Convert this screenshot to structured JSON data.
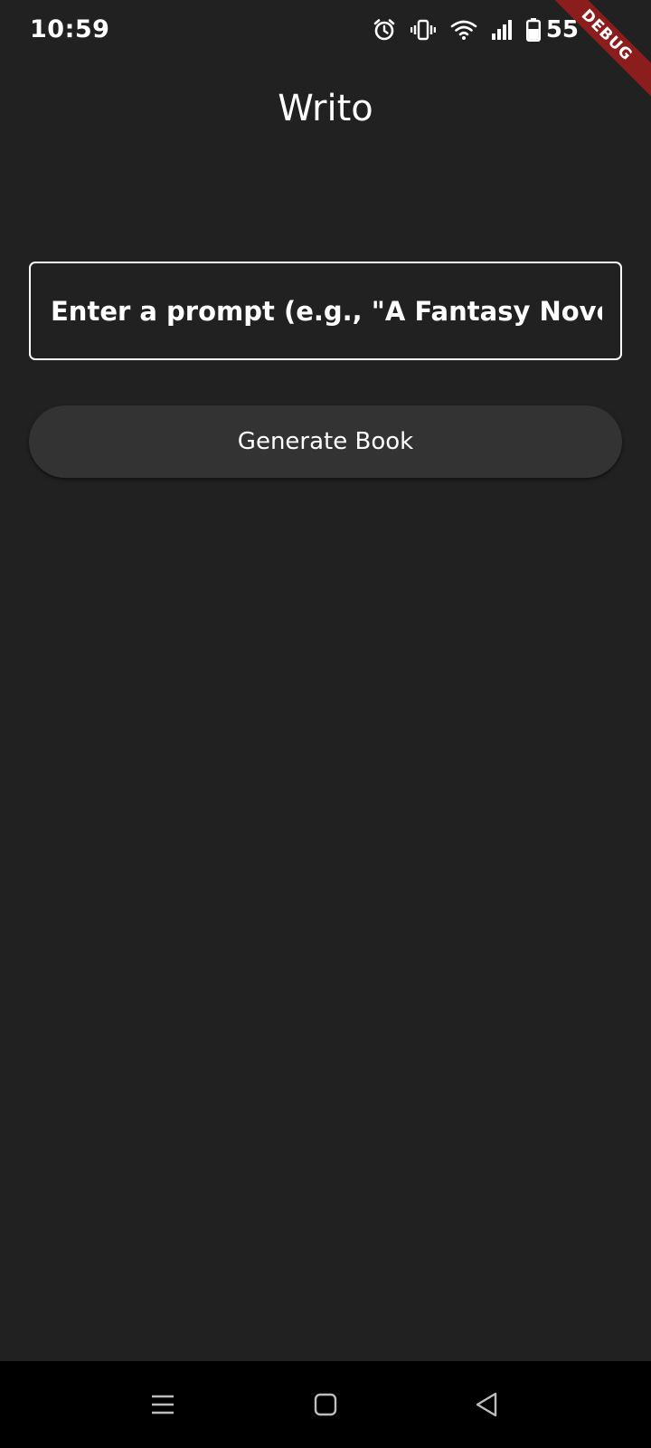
{
  "status_bar": {
    "time": "10:59",
    "battery_percent": "55",
    "icons": [
      "alarm-icon",
      "vibrate-icon",
      "wifi-icon",
      "signal-icon",
      "battery-icon"
    ]
  },
  "debug_banner": {
    "label": "DEBUG"
  },
  "header": {
    "title": "Writo"
  },
  "prompt": {
    "value": "",
    "placeholder": "Enter a prompt (e.g., \"A Fantasy Novel …"
  },
  "actions": {
    "generate_label": "Generate Book"
  },
  "nav_bar": {
    "icons": [
      "menu-icon",
      "home-icon",
      "back-icon"
    ]
  },
  "colors": {
    "background": "#212121",
    "button": "#333333",
    "ribbon": "#8c1d1d",
    "nav_bar": "#000000"
  }
}
